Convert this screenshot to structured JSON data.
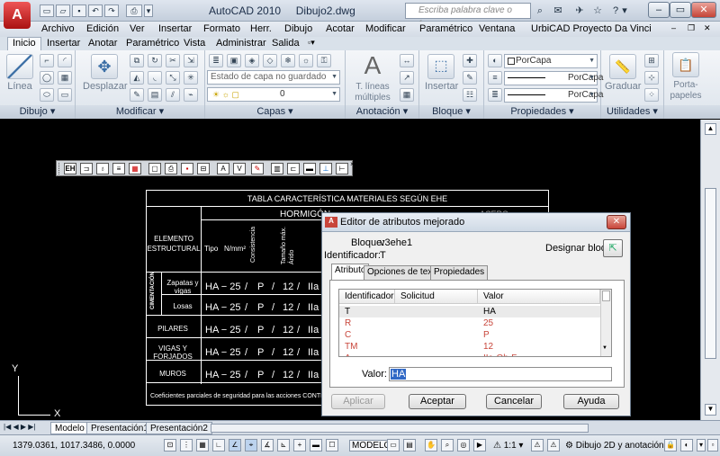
{
  "window": {
    "title": "AutoCAD 2010",
    "document": "Dibujo2.dwg",
    "search_placeholder": "Escriba palabra clave o frase"
  },
  "menu": [
    "Archivo",
    "Edición",
    "Ver",
    "Insertar",
    "Formato",
    "Herr.",
    "Dibujo",
    "Acotar",
    "Modificar",
    "Paramétrico",
    "Ventana",
    "UrbiCAD Proyecto Da Vinci"
  ],
  "tabs": [
    "Inicio",
    "Insertar",
    "Anotar",
    "Paramétrico",
    "Vista",
    "Administrar",
    "Salida"
  ],
  "ribbon": {
    "dibujo": {
      "title": "Dibujo",
      "linea": "Línea"
    },
    "modificar": {
      "title": "Modificar",
      "desplazar": "Desplazar"
    },
    "capas": {
      "title": "Capas",
      "state_combo": "Estado de capa no guardado",
      "layer_combo": "0"
    },
    "anotacion": {
      "title": "Anotación",
      "btn": "T. líneas múltiples"
    },
    "bloque": {
      "title": "Bloque",
      "btn": "Insertar"
    },
    "propiedades": {
      "title": "Propiedades",
      "color": "PorCapa",
      "linetype": "PorCapa",
      "lineweight": "PorCapa"
    },
    "utilidades": {
      "title": "Utilidades",
      "graduar": "Graduar"
    },
    "portapapeles": {
      "btn": "Porta-papeles"
    }
  },
  "table": {
    "title": "TABLA CARACTERÍSTICA MATERIALES SEGÚN EHE",
    "hormigon": "HORMIGÓN",
    "acero": "ACERO",
    "elemento": "ELEMENTO ESTRUCTURAL",
    "col_tipo": "Tipo",
    "col_nmm": "N/mm²",
    "col_consistencia": "Consistencia",
    "col_tamano": "Tamaño máx. Árido",
    "cimentacion": "CIMENTACIÓN",
    "rows": [
      {
        "label": "Zapatas y vigas",
        "tipo": "HA − 25",
        "c": "P",
        "t": "12",
        "amb": "IIa"
      },
      {
        "label": "Losas",
        "tipo": "HA − 25",
        "c": "P",
        "t": "12",
        "amb": "IIa"
      },
      {
        "label": "PILARES",
        "tipo": "HA − 25",
        "c": "P",
        "t": "12",
        "amb": "IIa"
      },
      {
        "label": "VIGAS Y FORJADOS",
        "tipo": "HA − 25",
        "c": "P",
        "t": "12",
        "amb": "IIa"
      },
      {
        "label": "MUROS",
        "tipo": "HA − 25",
        "c": "P",
        "t": "12",
        "amb": "IIa"
      }
    ],
    "slash": "/",
    "footer": "Coeficientes parciales de seguridad para las acciones CONTRO"
  },
  "dialog": {
    "title": "Editor de atributos mejorado",
    "bloque_label": "Bloque:",
    "bloque_value": "v3ehe1",
    "ident_label": "Identificador:",
    "ident_value": "T",
    "designar": "Designar bloque",
    "tabs": [
      "Atributo",
      "Opciones de texto",
      "Propiedades"
    ],
    "grid_headers": [
      "Identificador",
      "Solicitud",
      "Valor"
    ],
    "rows": [
      {
        "id": "T",
        "valor": "HA"
      },
      {
        "id": "R",
        "valor": "25"
      },
      {
        "id": "C",
        "valor": "P"
      },
      {
        "id": "TM",
        "valor": "12"
      },
      {
        "id": "A",
        "valor": "IIa-Qb-F"
      }
    ],
    "valor_label": "Valor:",
    "valor_value": "HA",
    "buttons": {
      "aplicar": "Aplicar",
      "aceptar": "Aceptar",
      "cancelar": "Cancelar",
      "ayuda": "Ayuda"
    }
  },
  "axes": {
    "y": "Y",
    "x": "X"
  },
  "layouts": [
    "Modelo",
    "Presentación1",
    "Presentación2"
  ],
  "status": {
    "coords": "1379.0361, 1017.3486, 0.0000",
    "modelo": "MODELO",
    "scale": "1:1",
    "workspace": "Dibujo 2D y anotación"
  },
  "colors": {
    "accent_red": "#c8453a",
    "selection": "#3169c6"
  }
}
